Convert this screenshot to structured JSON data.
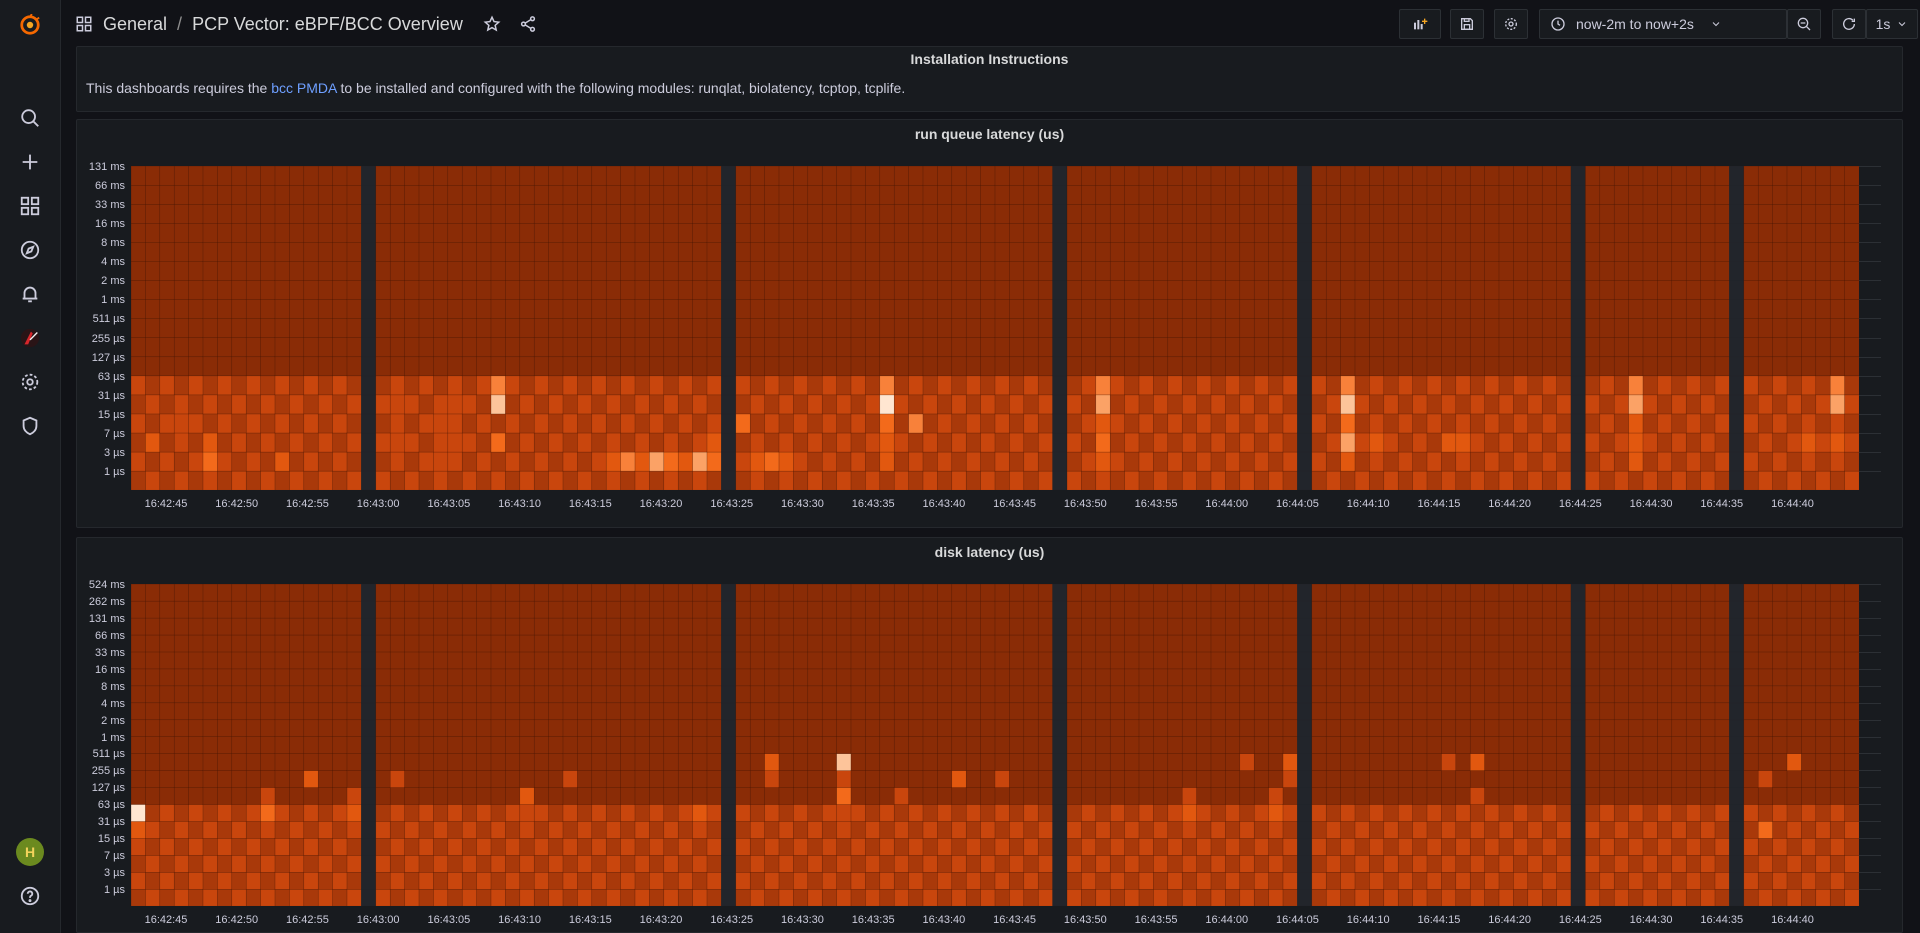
{
  "colors": {
    "base": "#8a2c06",
    "ramp": [
      "#8a2c06",
      "#a9390a",
      "#c9460d",
      "#e2580f",
      "#f36a1b",
      "#f8813a",
      "#fba266",
      "#fdc49a",
      "#ffe6d1"
    ],
    "separator": "#22252b"
  },
  "sidemenu": {
    "items": [
      {
        "icon": "grafana-logo-icon"
      },
      {
        "icon": "search-icon"
      },
      {
        "icon": "plus-icon"
      },
      {
        "icon": "dashboards-icon"
      },
      {
        "icon": "explore-icon"
      },
      {
        "icon": "alerting-icon"
      },
      {
        "icon": "pcp-icon"
      },
      {
        "icon": "gear-icon"
      },
      {
        "icon": "shield-icon"
      },
      {
        "icon": "avatar-icon"
      },
      {
        "icon": "help-icon"
      }
    ]
  },
  "header": {
    "folder": "General",
    "separator": "/",
    "title": "PCP Vector: eBPF/BCC Overview"
  },
  "toolbar": {
    "time_range": "now-2m to now+2s",
    "refresh_interval": "1s",
    "icons": [
      "add-panel-icon",
      "save-icon",
      "gear-icon",
      "clock-icon",
      "chevron-down-icon",
      "zoom-out-icon",
      "refresh-icon",
      "chevron-down-icon",
      "tv-mode-icon"
    ]
  },
  "panels": {
    "info": {
      "title": "Installation Instructions",
      "text_before": "This dashboards requires the",
      "link": "bcc PMDA",
      "text_after": "to be installed and configured with the following modules: runqlat, biolatency, tcptop, tcplife."
    },
    "runq": {
      "title": "run queue latency (us)"
    },
    "disk": {
      "title": "disk latency (us)"
    }
  },
  "chart_data": [
    {
      "type": "heatmap",
      "title": "run queue latency (us)",
      "y_buckets": [
        "1 µs",
        "3 µs",
        "7 µs",
        "15 µs",
        "31 µs",
        "63 µs",
        "127 µs",
        "255 µs",
        "511 µs",
        "1 ms",
        "2 ms",
        "4 ms",
        "8 ms",
        "16 ms",
        "33 ms",
        "66 ms",
        "131 ms"
      ],
      "x_ticks": [
        "16:42:45",
        "16:42:50",
        "16:42:55",
        "16:43:00",
        "16:43:05",
        "16:43:10",
        "16:43:15",
        "16:43:20",
        "16:43:25",
        "16:43:30",
        "16:43:35",
        "16:43:40",
        "16:43:45",
        "16:43:50",
        "16:43:55",
        "16:44:00",
        "16:44:05",
        "16:44:10",
        "16:44:15",
        "16:44:20",
        "16:44:25",
        "16:44:30",
        "16:44:35",
        "16:44:40"
      ],
      "columns": 120,
      "gaps": [
        16,
        41,
        64,
        81,
        100,
        111
      ],
      "hot_cells": [
        [
          1,
          2,
          3
        ],
        [
          1,
          4,
          2
        ],
        [
          3,
          3,
          2
        ],
        [
          5,
          1,
          4
        ],
        [
          5,
          2,
          3
        ],
        [
          10,
          1,
          3
        ],
        [
          10,
          3,
          2
        ],
        [
          18,
          2,
          2
        ],
        [
          18,
          4,
          2
        ],
        [
          21,
          1,
          2
        ],
        [
          21,
          3,
          2
        ],
        [
          22,
          2,
          2
        ],
        [
          22,
          4,
          2
        ],
        [
          25,
          5,
          5
        ],
        [
          25,
          4,
          7
        ],
        [
          25,
          2,
          4
        ],
        [
          28,
          3,
          2
        ],
        [
          33,
          1,
          3
        ],
        [
          34,
          1,
          5
        ],
        [
          35,
          1,
          3
        ],
        [
          36,
          1,
          6
        ],
        [
          37,
          1,
          4
        ],
        [
          38,
          1,
          3
        ],
        [
          39,
          1,
          6
        ],
        [
          40,
          1,
          4
        ],
        [
          40,
          2,
          3
        ],
        [
          41,
          1,
          2
        ],
        [
          42,
          3,
          4
        ],
        [
          43,
          1,
          3
        ],
        [
          44,
          1,
          4
        ],
        [
          45,
          1,
          3
        ],
        [
          52,
          5,
          5
        ],
        [
          52,
          4,
          8
        ],
        [
          52,
          3,
          4
        ],
        [
          52,
          2,
          3
        ],
        [
          52,
          1,
          3
        ],
        [
          54,
          3,
          5
        ],
        [
          54,
          1,
          2
        ],
        [
          67,
          5,
          5
        ],
        [
          67,
          4,
          6
        ],
        [
          67,
          3,
          3
        ],
        [
          67,
          2,
          4
        ],
        [
          67,
          1,
          3
        ],
        [
          84,
          5,
          5
        ],
        [
          84,
          4,
          7
        ],
        [
          84,
          3,
          4
        ],
        [
          84,
          2,
          6
        ],
        [
          84,
          1,
          3
        ],
        [
          86,
          2,
          3
        ],
        [
          91,
          2,
          3
        ],
        [
          92,
          2,
          3
        ],
        [
          104,
          5,
          5
        ],
        [
          104,
          4,
          6
        ],
        [
          104,
          3,
          3
        ],
        [
          104,
          2,
          3
        ],
        [
          104,
          1,
          3
        ],
        [
          116,
          2,
          3
        ],
        [
          118,
          5,
          5
        ],
        [
          118,
          4,
          6
        ],
        [
          118,
          2,
          3
        ]
      ]
    },
    {
      "type": "heatmap",
      "title": "disk latency (us)",
      "y_buckets": [
        "1 µs",
        "3 µs",
        "7 µs",
        "15 µs",
        "31 µs",
        "63 µs",
        "127 µs",
        "255 µs",
        "511 µs",
        "1 ms",
        "2 ms",
        "4 ms",
        "8 ms",
        "16 ms",
        "33 ms",
        "66 ms",
        "131 ms",
        "262 ms",
        "524 ms"
      ],
      "x_ticks": [
        "16:42:45",
        "16:42:50",
        "16:42:55",
        "16:43:00",
        "16:43:05",
        "16:43:10",
        "16:43:15",
        "16:43:20",
        "16:43:25",
        "16:43:30",
        "16:43:35",
        "16:43:40",
        "16:43:45",
        "16:43:50",
        "16:43:55",
        "16:44:00",
        "16:44:05",
        "16:44:10",
        "16:44:15",
        "16:44:20",
        "16:44:25",
        "16:44:30",
        "16:44:35",
        "16:44:40"
      ],
      "columns": 120,
      "gaps": [
        16,
        41,
        64,
        81,
        100,
        111
      ],
      "hot_cells": [
        [
          0,
          5,
          8
        ],
        [
          0,
          4,
          3
        ],
        [
          9,
          5,
          4
        ],
        [
          9,
          6,
          2
        ],
        [
          12,
          7,
          3
        ],
        [
          12,
          5,
          2
        ],
        [
          15,
          5,
          3
        ],
        [
          15,
          6,
          2
        ],
        [
          18,
          7,
          2
        ],
        [
          27,
          6,
          3
        ],
        [
          27,
          5,
          2
        ],
        [
          30,
          7,
          2
        ],
        [
          34,
          5,
          2
        ],
        [
          39,
          5,
          3
        ],
        [
          39,
          4,
          2
        ],
        [
          44,
          8,
          3
        ],
        [
          44,
          7,
          2
        ],
        [
          49,
          8,
          7
        ],
        [
          49,
          7,
          2
        ],
        [
          49,
          6,
          4
        ],
        [
          49,
          5,
          2
        ],
        [
          53,
          6,
          2
        ],
        [
          57,
          7,
          3
        ],
        [
          60,
          7,
          2
        ],
        [
          64,
          7,
          2
        ],
        [
          73,
          6,
          2
        ],
        [
          73,
          5,
          3
        ],
        [
          77,
          8,
          2
        ],
        [
          79,
          5,
          3
        ],
        [
          79,
          6,
          2
        ],
        [
          80,
          8,
          3
        ],
        [
          80,
          7,
          2
        ],
        [
          91,
          8,
          2
        ],
        [
          93,
          8,
          3
        ],
        [
          93,
          6,
          2
        ],
        [
          113,
          4,
          4
        ],
        [
          113,
          7,
          2
        ],
        [
          115,
          8,
          3
        ]
      ]
    }
  ]
}
